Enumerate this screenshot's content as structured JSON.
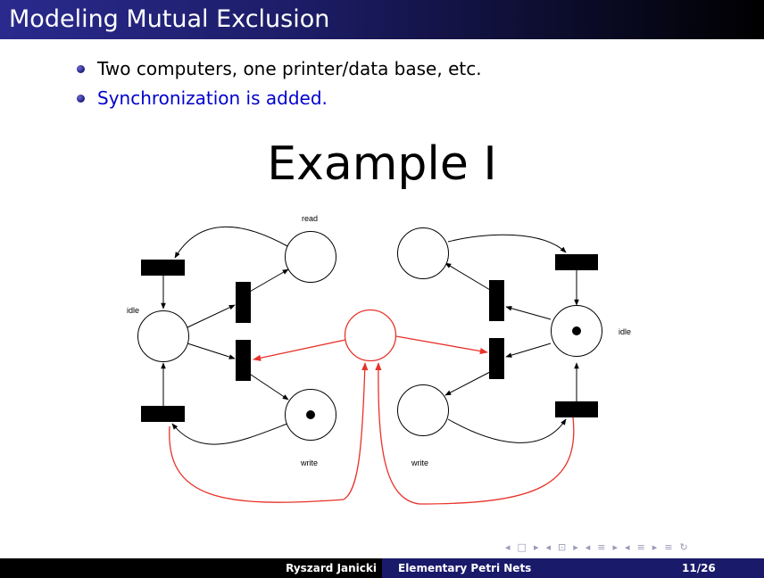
{
  "slide": {
    "title": "Modeling Mutual Exclusion",
    "bullets": [
      "Two computers, one printer/data base, etc.",
      "Synchronization is added."
    ],
    "heading": "Example I"
  },
  "diagram": {
    "labels": {
      "read": "read",
      "idle_left": "idle",
      "idle_right": "idle",
      "write_left": "write",
      "write_right": "write"
    },
    "colors": {
      "arc": "#000000",
      "sync_arc": "#e8322a",
      "transition": "#000000"
    }
  },
  "footer": {
    "author": "Ryszard Janicki",
    "short_title": "Elementary Petri Nets",
    "page": "11/26"
  },
  "navigation": {
    "symbols": [
      "◂",
      "□",
      "▸",
      "◂",
      "⊡",
      "▸",
      "◂",
      "≡",
      "▸",
      "◂",
      "≡",
      "▸",
      "≡",
      "↻"
    ]
  }
}
